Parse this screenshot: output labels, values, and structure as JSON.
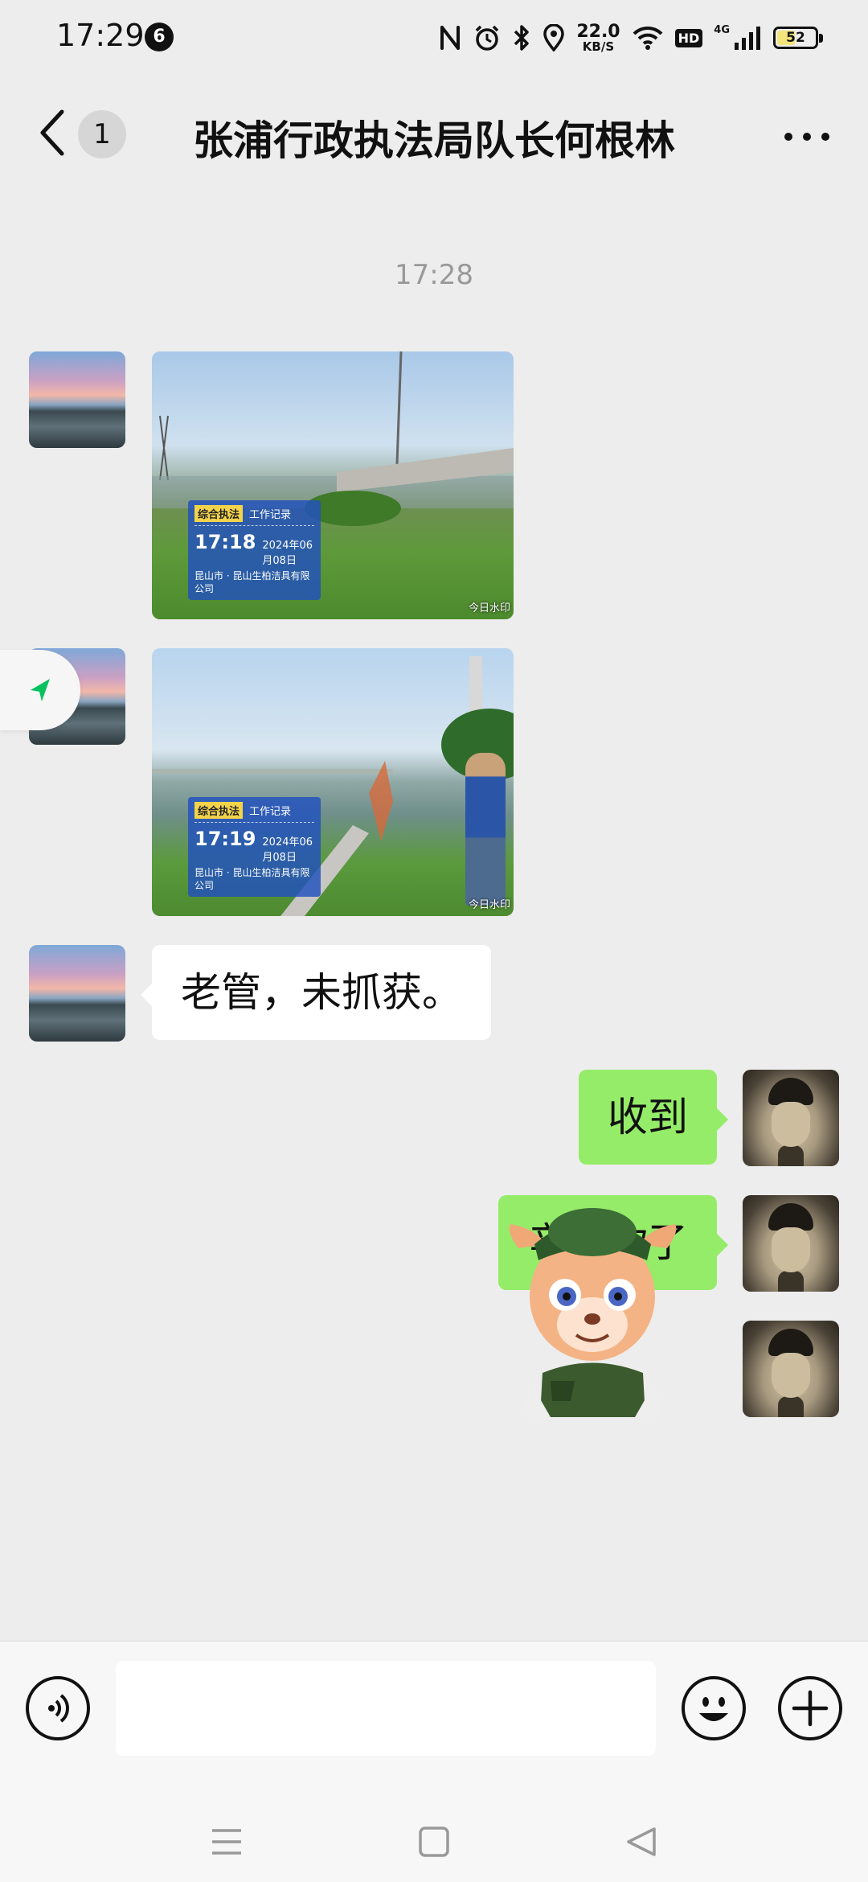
{
  "status_bar": {
    "time": "17:29",
    "notification_count": "6",
    "net_speed_value": "22.0",
    "net_speed_unit": "KB/S",
    "hd_label": "HD",
    "network_label": "4G",
    "battery": "52",
    "battery_color": "#f2e47a"
  },
  "header": {
    "unread_count": "1",
    "title": "张浦行政执法局队长何根林"
  },
  "chat": {
    "timestamp": "17:28",
    "messages": [
      {
        "side": "left",
        "type": "image",
        "watermark": {
          "tag": "综合执法",
          "label": "工作记录",
          "time": "17:18",
          "date": "2024年06月08日",
          "address": "昆山市 · 昆山生柏洁具有限公司",
          "brand": "今日水印"
        }
      },
      {
        "side": "left",
        "type": "image",
        "watermark": {
          "tag": "综合执法",
          "label": "工作记录",
          "time": "17:19",
          "date": "2024年06月08日",
          "address": "昆山市 · 昆山生柏洁具有限公司",
          "brand": "今日水印"
        }
      },
      {
        "side": "left",
        "type": "text",
        "text": "老管，未抓获。"
      },
      {
        "side": "right",
        "type": "text",
        "text": "收到"
      },
      {
        "side": "right",
        "type": "text",
        "text": "辛苦你了"
      },
      {
        "side": "right",
        "type": "sticker",
        "icon": "deer-mascot-sticker"
      }
    ]
  },
  "input_bar": {
    "placeholder": "",
    "icons": [
      "voice-icon",
      "emoji-icon",
      "plus-icon"
    ]
  },
  "nav_bar": {
    "icons": [
      "menu-icon",
      "home-icon",
      "back-icon"
    ]
  },
  "colors": {
    "background": "#ededed",
    "bubble_self": "#95ec69",
    "bubble_other": "#ffffff",
    "accent_green": "#07c160"
  }
}
